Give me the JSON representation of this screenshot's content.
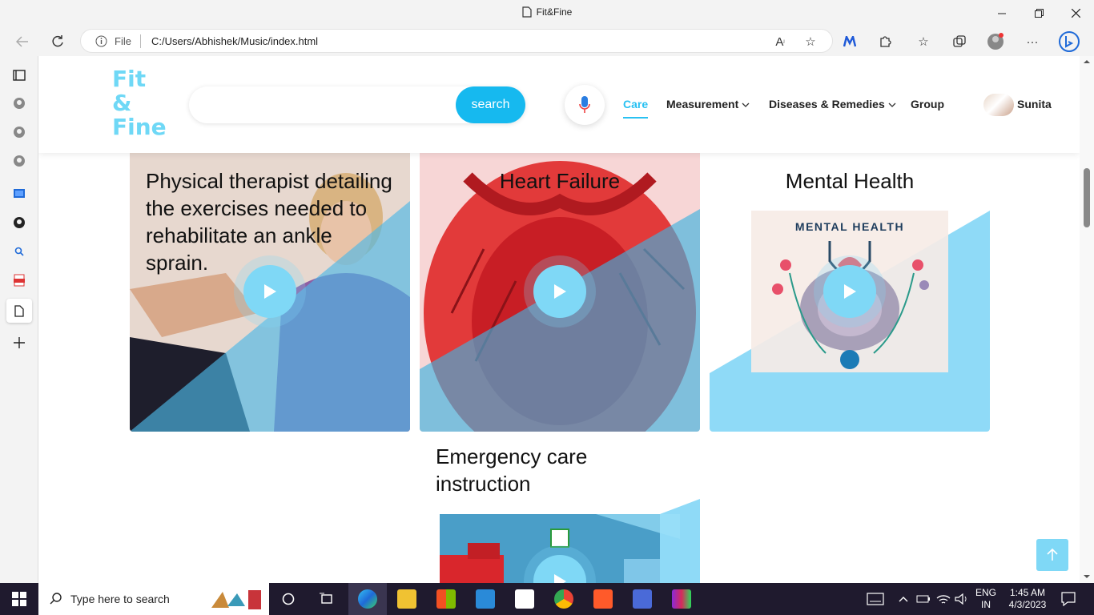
{
  "browser": {
    "tab_title": "Fit&Fine",
    "scheme_label": "File",
    "url": "C:/Users/Abhishek/Music/index.html"
  },
  "site": {
    "logo_lines": [
      "Fit",
      "&",
      "Fine"
    ],
    "search_button": "search",
    "nav": {
      "care": "Care",
      "measurement": "Measurement",
      "diseases": "Diseases & Remedies",
      "group": "Group"
    },
    "user_name": "Sunita",
    "accent_color": "#29c1f2"
  },
  "cards": [
    {
      "title": "Physical therapist detailing the exercises needed to rehabilitate an ankle sprain."
    },
    {
      "title": "Heart Failure"
    },
    {
      "title": "Mental Health",
      "image_caption": "MENTAL HEALTH"
    },
    {
      "title": "Emergency care instruction"
    }
  ],
  "taskbar": {
    "search_placeholder": "Type here to search",
    "lang_top": "ENG",
    "lang_bottom": "IN",
    "time": "1:45 AM",
    "date": "4/3/2023"
  }
}
